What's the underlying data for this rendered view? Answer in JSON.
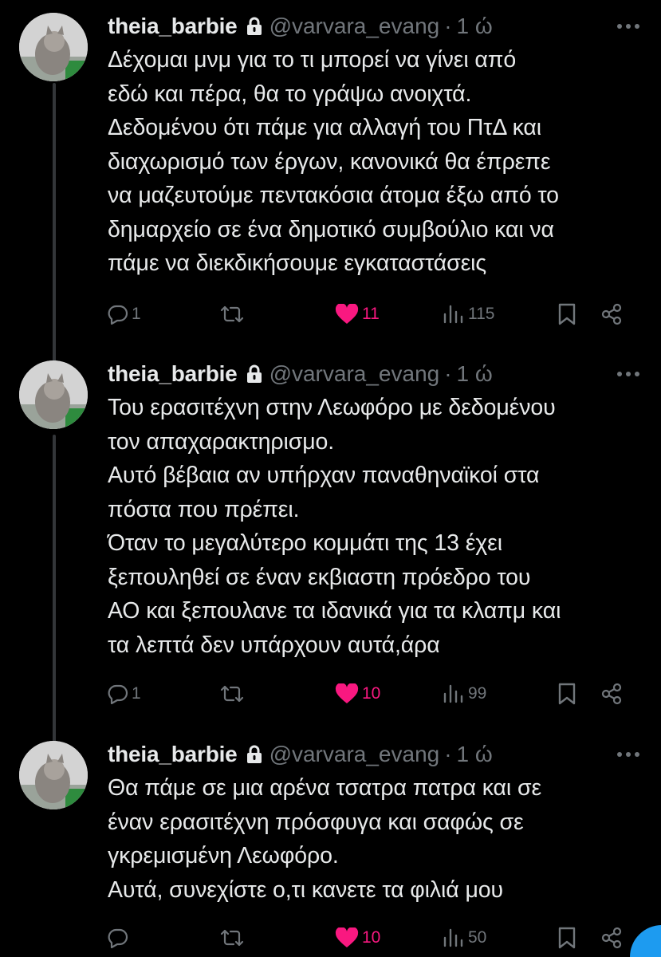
{
  "colors": {
    "background": "#000000",
    "text": "#e7e9ea",
    "secondary": "#71767b",
    "like": "#f91880",
    "accent": "#1d9bf0",
    "thread_line": "#333639"
  },
  "tweets": [
    {
      "display_name": "theia_barbie",
      "lock_icon": "lock-icon",
      "handle": "@varvara_evang",
      "separator": "·",
      "time": "1 ώ",
      "text": "Δέχομαι μνμ για το τι μπορεί να γίνει από\nεδώ και πέρα, θα το γράψω ανοιχτά.\nΔεδομένου ότι πάμε για αλλαγή του ΠτΔ και\nδιαχωρισμό των έργων, κανονικά θα έπρεπε\nνα μαζευτούμε πεντακόσια άτομα έξω από το\nδημαρχείο σε ένα δημοτικό συμβούλιο και να\nπάμε να διεκδικήσουμε εγκαταστάσεις",
      "replies": "1",
      "retweets": "",
      "likes": "11",
      "liked": true,
      "views": "115"
    },
    {
      "display_name": "theia_barbie",
      "lock_icon": "lock-icon",
      "handle": "@varvara_evang",
      "separator": "·",
      "time": "1 ώ",
      "text": "Του ερασιτέχνη στην Λεωφόρο με δεδομένου\nτον απαχαρακτηρισμο.\nΑυτό βέβαια αν υπήρχαν παναθηναϊκοί στα\nπόστα που πρέπει.\nΌταν το μεγαλύτερο κομμάτι της 13 έχει\nξεπουληθεί σε έναν εκβιαστη πρόεδρο του\nΑΟ και ξεπουλανε τα ιδανικά για τα κλαπμ και\nτα λεπτά δεν υπάρχουν αυτά,άρα",
      "replies": "1",
      "retweets": "",
      "likes": "10",
      "liked": true,
      "views": "99"
    },
    {
      "display_name": "theia_barbie",
      "lock_icon": "lock-icon",
      "handle": "@varvara_evang",
      "separator": "·",
      "time": "1 ώ",
      "text": "Θα πάμε σε μια αρένα τσατρα πατρα και σε\nέναν ερασιτέχνη πρόσφυγα και σαφώς σε\nγκρεμισμένη Λεωφόρο.\nΑυτά, συνεχίστε ο,τι κανετε τα φιλιά μου",
      "replies": "",
      "retweets": "",
      "likes": "10",
      "liked": true,
      "views": "50"
    }
  ]
}
